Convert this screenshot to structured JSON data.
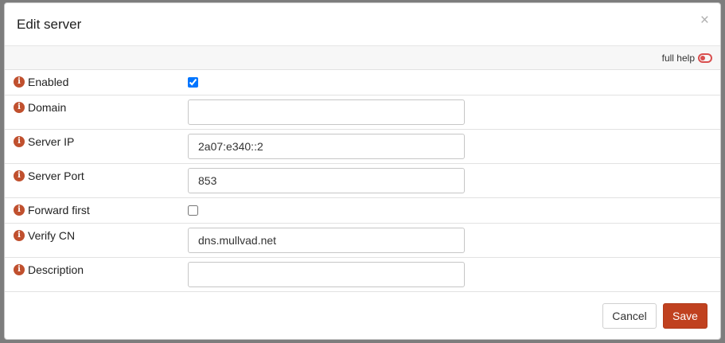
{
  "dialog": {
    "title": "Edit server",
    "close_glyph": "×",
    "full_help_label": "full help"
  },
  "fields": {
    "enabled": {
      "label": "Enabled",
      "checked": true
    },
    "domain": {
      "label": "Domain",
      "value": ""
    },
    "server_ip": {
      "label": "Server IP",
      "value": "2a07:e340::2"
    },
    "server_port": {
      "label": "Server Port",
      "value": "853"
    },
    "forward_first": {
      "label": "Forward first",
      "checked": false
    },
    "verify_cn": {
      "label": "Verify CN",
      "value": "dns.mullvad.net"
    },
    "description": {
      "label": "Description",
      "value": ""
    }
  },
  "footer": {
    "cancel_label": "Cancel",
    "save_label": "Save"
  },
  "icons": {
    "info": "info-icon",
    "toggle": "toggle-off-icon",
    "close": "close-icon"
  },
  "colors": {
    "accent": "#c0411f",
    "info_icon": "#c0502e",
    "toggle": "#d94f4f"
  }
}
